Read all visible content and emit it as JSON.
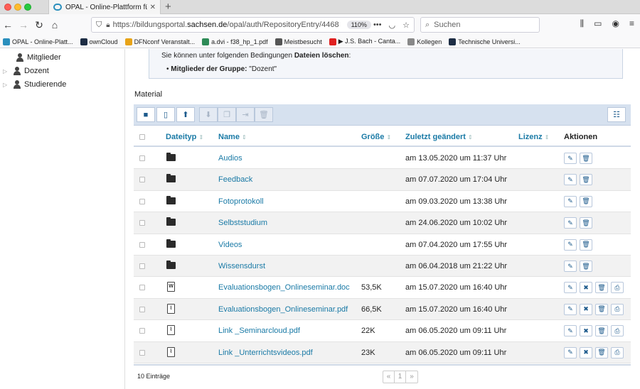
{
  "browser": {
    "tab_title": "OPAL - Online-Plattform für Ak",
    "tab_close": "✕",
    "new_tab": "+",
    "url_prefix": "https://bildungsportal.",
    "url_domain": "sachsen.de",
    "url_path": "/opal/auth/RepositoryEntry/4468",
    "zoom": "110%",
    "search_placeholder": "Suchen"
  },
  "bookmarks": [
    {
      "label": "OPAL - Online-Platt...",
      "color": "#2a8fbd"
    },
    {
      "label": "ownCloud",
      "color": "#1d2d44"
    },
    {
      "label": "DFNconf Veranstalt...",
      "color": "#e8a317"
    },
    {
      "label": "a.dvi - f38_hp_1.pdf",
      "color": "#2e8b57"
    },
    {
      "label": "Meistbesucht",
      "color": "#555555"
    },
    {
      "label": "▶ J.S. Bach - Canta...",
      "color": "#e02020"
    },
    {
      "label": "Kollegen",
      "color": "#888888"
    },
    {
      "label": "Technische Universi...",
      "color": "#1d2d44"
    }
  ],
  "sidebar": {
    "items": [
      {
        "label": "Mitglieder"
      },
      {
        "label": "Dozent"
      },
      {
        "label": "Studierende"
      }
    ]
  },
  "info": {
    "line1_prefix": "Sie können unter folgenden Bedingungen ",
    "line1_bold": "Dateien löschen",
    "line1_suffix": ":",
    "line2_bold": "Mitglieder der Gruppe:",
    "line2_value": " \"Dozent\""
  },
  "material": {
    "heading": "Material",
    "columns": {
      "type": "Dateityp",
      "name": "Name",
      "size": "Größe",
      "modified": "Zuletzt geändert",
      "license": "Lizenz",
      "actions": "Aktionen"
    },
    "rows": [
      {
        "name": "Audios",
        "size": "",
        "modified": "am 13.05.2020 um 11:37 Uhr",
        "kind": "folder"
      },
      {
        "name": "Feedback",
        "size": "",
        "modified": "am 07.07.2020 um 17:04 Uhr",
        "kind": "folder"
      },
      {
        "name": "Fotoprotokoll",
        "size": "",
        "modified": "am 09.03.2020 um 13:38 Uhr",
        "kind": "folder"
      },
      {
        "name": "Selbststudium",
        "size": "",
        "modified": "am 24.06.2020 um 10:02 Uhr",
        "kind": "folder"
      },
      {
        "name": "Videos",
        "size": "",
        "modified": "am 07.04.2020 um 17:55 Uhr",
        "kind": "folder"
      },
      {
        "name": "Wissensdurst",
        "size": "",
        "modified": "am 06.04.2018 um 21:22 Uhr",
        "kind": "folder"
      },
      {
        "name": "Evaluationsbogen_Onlineseminar.doc",
        "size": "53,5K",
        "modified": "am 15.07.2020 um 16:40 Uhr",
        "kind": "doc"
      },
      {
        "name": "Evaluationsbogen_Onlineseminar.pdf",
        "size": "66,5K",
        "modified": "am 15.07.2020 um 16:40 Uhr",
        "kind": "pdf"
      },
      {
        "name": "Link _Seminarcloud.pdf",
        "size": "22K",
        "modified": "am 06.05.2020 um 09:11 Uhr",
        "kind": "pdf"
      },
      {
        "name": "Link _Unterrichtsvideos.pdf",
        "size": "23K",
        "modified": "am 06.05.2020 um 09:11 Uhr",
        "kind": "pdf"
      }
    ],
    "entry_count": "10 Einträge",
    "pager": {
      "prev": "«",
      "page": "1",
      "next": "»"
    }
  }
}
